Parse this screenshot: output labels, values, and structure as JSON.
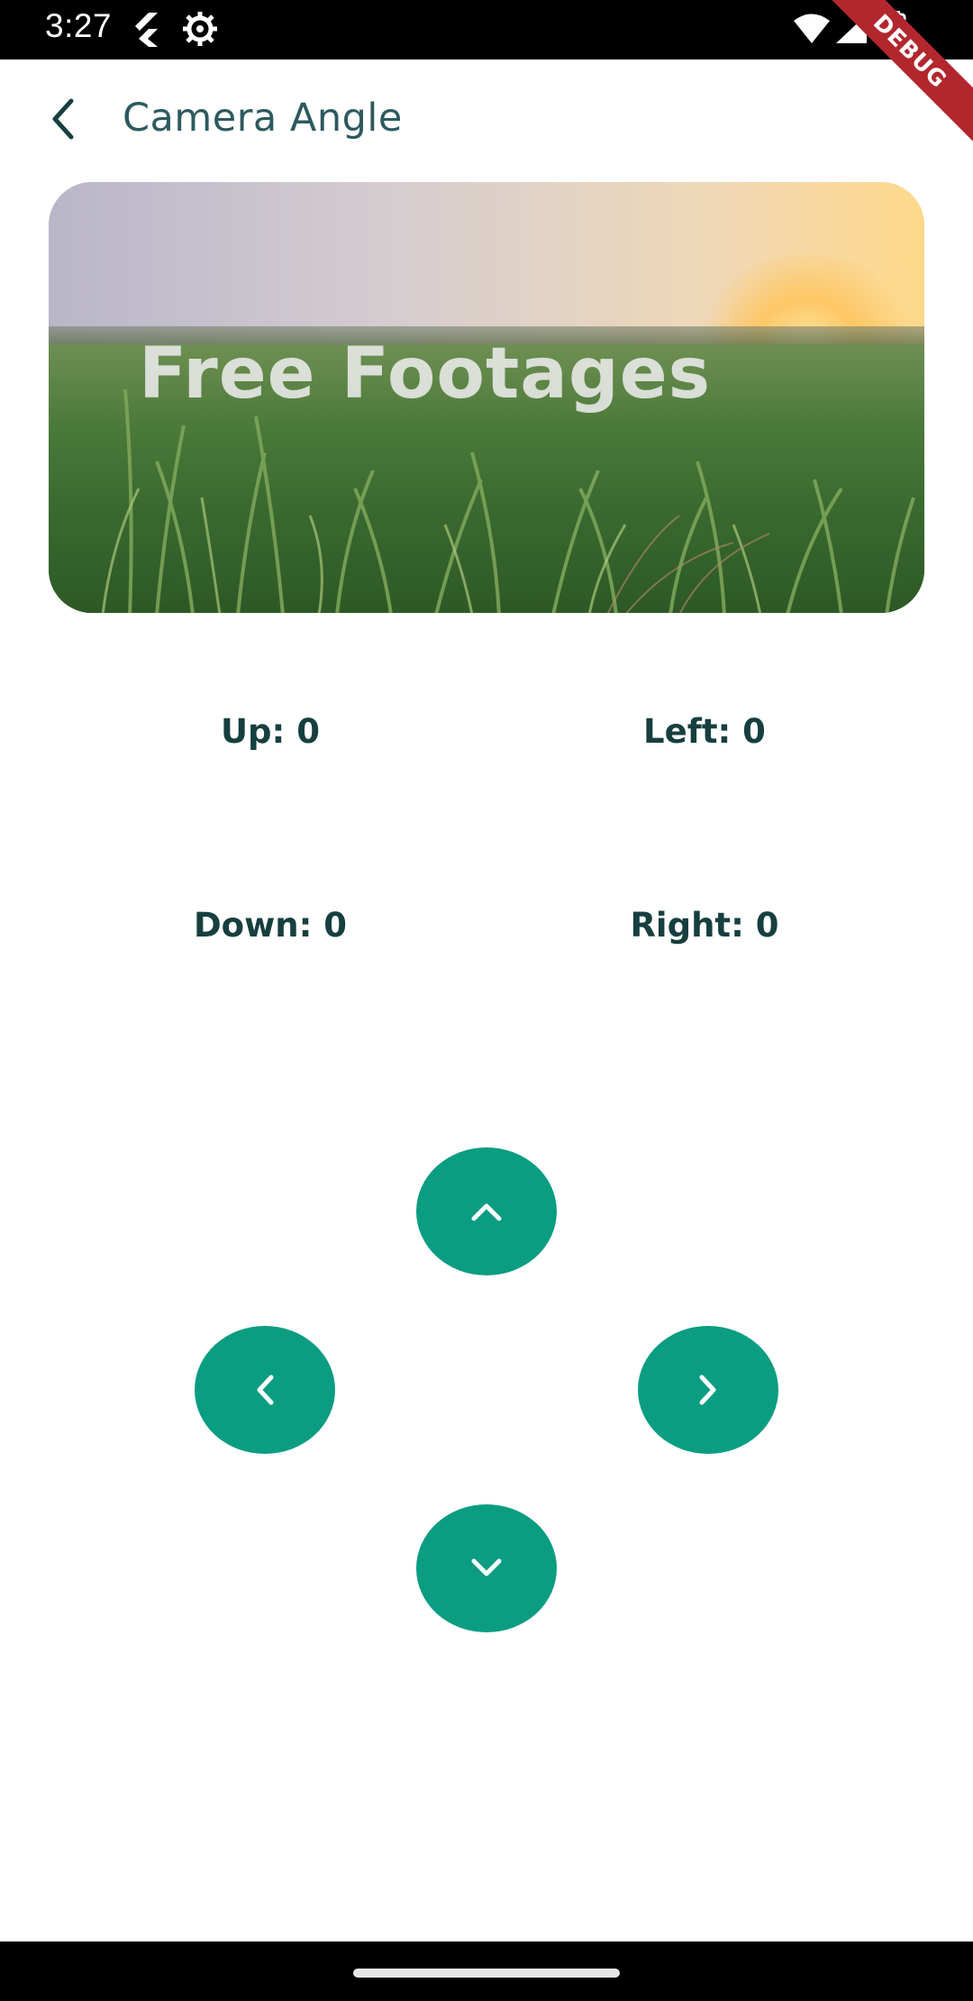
{
  "status_bar": {
    "time": "3:27",
    "icons": [
      "flutter-icon",
      "gear-icon",
      "wifi-icon",
      "cellular-signal-icon",
      "battery-icon"
    ]
  },
  "debug_banner": {
    "label": "DEBUG"
  },
  "app_bar": {
    "title": "Camera Angle",
    "back_icon": "chevron-left-icon"
  },
  "media": {
    "overlay_text": "Free Footages"
  },
  "counters": {
    "up": "Up: 0",
    "left": "Left: 0",
    "down": "Down: 0",
    "right": "Right: 0"
  },
  "controls": {
    "up_icon": "chevron-up-icon",
    "left_icon": "chevron-left-icon",
    "right_icon": "chevron-right-icon",
    "down_icon": "chevron-down-icon"
  },
  "colors": {
    "accent": "#0a9d82",
    "title_text": "#2d5a5e",
    "counter_text": "#173f3f",
    "debug_banner": "#b3262e"
  }
}
